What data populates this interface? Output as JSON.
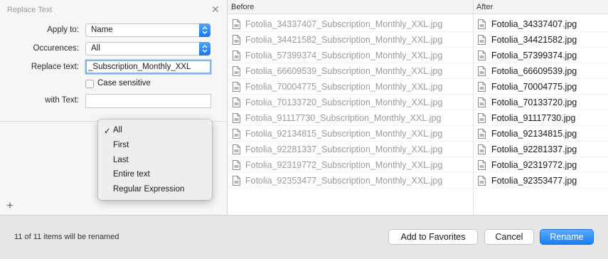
{
  "panel": {
    "title": "Replace Text",
    "apply_to_label": "Apply to:",
    "apply_to_value": "Name",
    "occurences_label": "Occurences:",
    "occurences_value": "All",
    "replace_text_label": "Replace text:",
    "replace_text_value": "_Subscription_Monthly_XXL",
    "case_sensitive_label": "Case sensitive",
    "with_text_label": "with Text:",
    "with_text_value": ""
  },
  "menu": {
    "items": [
      "All",
      "First",
      "Last",
      "Entire text",
      "Regular Expression"
    ],
    "selected": "All"
  },
  "table": {
    "headers": [
      "Before",
      "After"
    ],
    "rows": [
      {
        "before": "Fotolia_34337407_Subscription_Monthly_XXL.jpg",
        "after": "Fotolia_34337407.jpg"
      },
      {
        "before": "Fotolia_34421582_Subscription_Monthly_XXL.jpg",
        "after": "Fotolia_34421582.jpg"
      },
      {
        "before": "Fotolia_57399374_Subscription_Monthly_XXL.jpg",
        "after": "Fotolia_57399374.jpg"
      },
      {
        "before": "Fotolia_66609539_Subscription_Monthly_XXL.jpg",
        "after": "Fotolia_66609539.jpg"
      },
      {
        "before": "Fotolia_70004775_Subscription_Monthly_XXL.jpg",
        "after": "Fotolia_70004775.jpg"
      },
      {
        "before": "Fotolia_70133720_Subscription_Monthly_XXL.jpg",
        "after": "Fotolia_70133720.jpg"
      },
      {
        "before": "Fotolia_91117730_Subscription_Monthly_XXL.jpg",
        "after": "Fotolia_91117730.jpg"
      },
      {
        "before": "Fotolia_92134815_Subscription_Monthly_XXL.jpg",
        "after": "Fotolia_92134815.jpg"
      },
      {
        "before": "Fotolia_92281337_Subscription_Monthly_XXL.jpg",
        "after": "Fotolia_92281337.jpg"
      },
      {
        "before": "Fotolia_92319772_Subscription_Monthly_XXL.jpg",
        "after": "Fotolia_92319772.jpg"
      },
      {
        "before": "Fotolia_92353477_Subscription_Monthly_XXL.jpg",
        "after": "Fotolia_92353477.jpg"
      }
    ]
  },
  "footer": {
    "status": "11 of 11 items will be renamed",
    "add_favorites_label": "Add to Favorites",
    "cancel_label": "Cancel",
    "rename_label": "Rename"
  },
  "icons": {
    "close": "close-icon",
    "stepper": "chevron-updown-icon",
    "add": "plus-icon",
    "file": "file-icon",
    "check": "checkmark-icon"
  },
  "colors": {
    "accent": "#1a7ff5",
    "before_text": "#9a9a9a"
  }
}
